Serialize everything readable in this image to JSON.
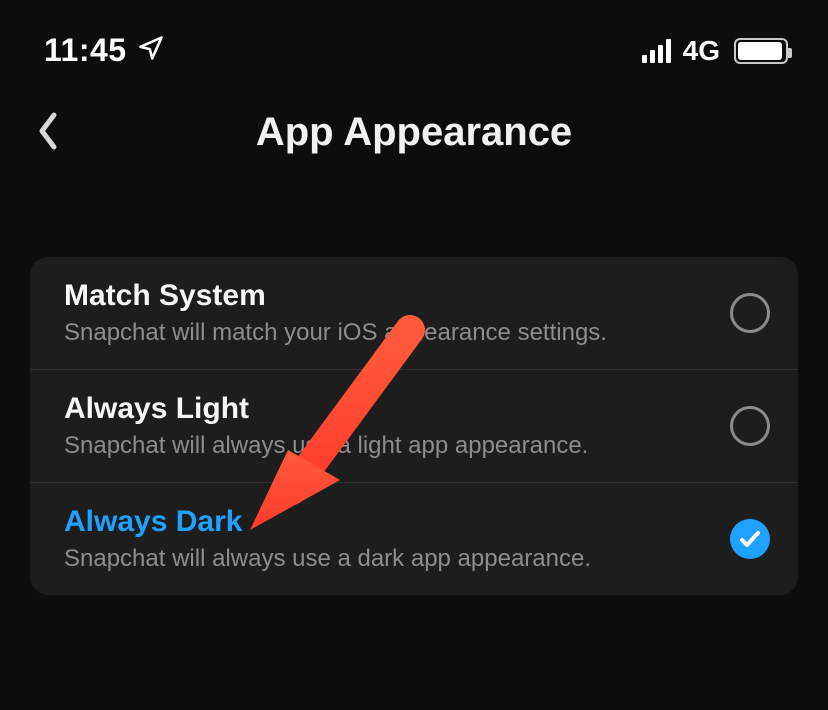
{
  "status_bar": {
    "time": "11:45",
    "network_label": "4G"
  },
  "header": {
    "title": "App Appearance"
  },
  "options": [
    {
      "title": "Match System",
      "subtitle": "Snapchat will match your iOS appearance settings.",
      "selected": false
    },
    {
      "title": "Always Light",
      "subtitle": "Snapchat will always use a light app appearance.",
      "selected": false
    },
    {
      "title": "Always Dark",
      "subtitle": "Snapchat will always use a dark app appearance.",
      "selected": true
    }
  ],
  "colors": {
    "accent": "#1ea1ff",
    "annotation_arrow": "#ff4533"
  }
}
